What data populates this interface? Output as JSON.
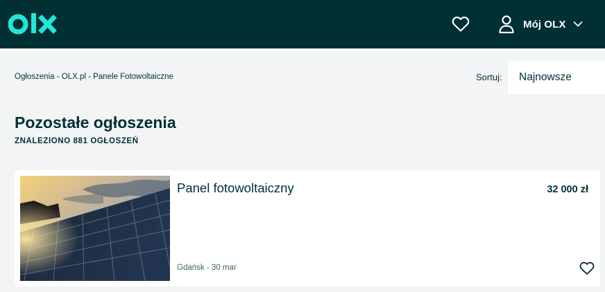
{
  "header": {
    "logo_text": "olx",
    "favorites_icon": "heart-outline-icon",
    "account_icon": "user-icon",
    "account_label": "Mój OLX",
    "account_chevron_icon": "chevron-down-icon",
    "background_color": "#002f34",
    "accent_color": "#23e5db"
  },
  "toolbar": {
    "breadcrumb": [
      "Ogłoszenia - OLX.pl",
      "Panele Fotowoltaiczne"
    ],
    "breadcrumb_separator": " - ",
    "sort_label": "Sortuj:",
    "sort_value": "Najnowsze"
  },
  "listing": {
    "title": "Pozostałe ogłoszenia",
    "count_text": "ZNALEZIONO 881 OGŁOSZEŃ"
  },
  "cards": [
    {
      "title": "Panel fotowoltaiczny",
      "price": "32 000 zł",
      "location": "Gdańsk",
      "date": "30 mar",
      "meta_separator": " - ",
      "image_subject": "solar-panels-at-sunset",
      "favorite_icon": "heart-outline-icon"
    }
  ]
}
